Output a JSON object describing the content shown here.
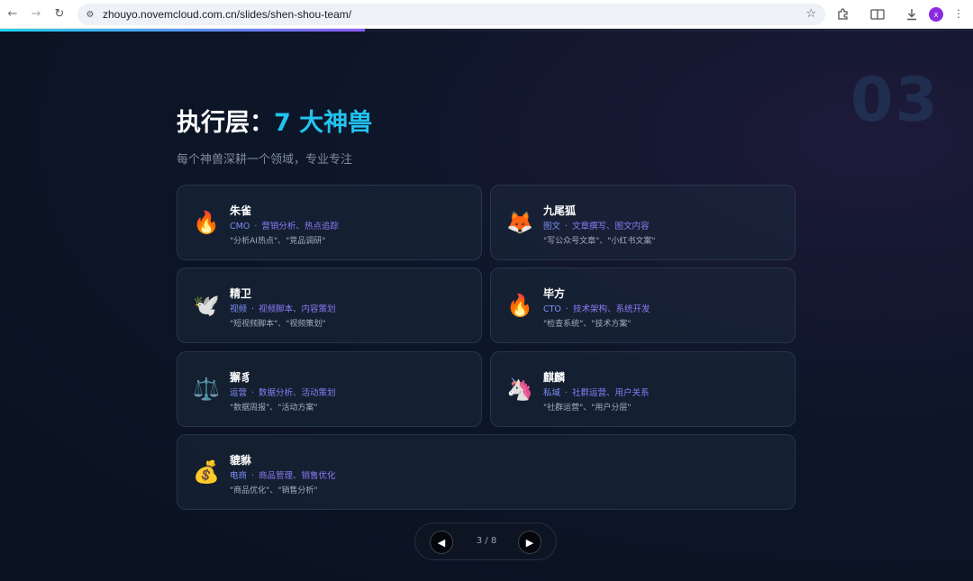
{
  "browser": {
    "url": "zhouyo.novemcloud.com.cn/slides/shen-shou-team/",
    "avatar_initial": "x",
    "icons": {
      "back": "arrow-left-icon",
      "forward": "arrow-right-icon",
      "reload": "reload-icon",
      "site": "tune-icon",
      "bookmark": "star-icon",
      "extensions": "puzzle-icon",
      "reader": "reading-mode-icon",
      "download": "download-icon",
      "menu": "more-vertical-icon"
    }
  },
  "slide": {
    "progress": 0.375,
    "progress_color_start": "#22d3ee",
    "progress_color_end": "#8b5cf6",
    "accent_color": "#22c3f0",
    "big_number": "03",
    "title_prefix": "执行层：",
    "title_accent": "7 大神兽",
    "subtitle": "每个神兽深耕一个领域，专业专注",
    "cards": [
      {
        "emoji": "🔥",
        "icon": "fire-icon",
        "name": "朱雀",
        "role": "CMO",
        "skills": "营销分析、热点追踪",
        "examples": "\"分析AI热点\"、\"竞品调研\""
      },
      {
        "emoji": "🦊",
        "icon": "fox-icon",
        "name": "九尾狐",
        "role": "图文",
        "skills": "文章撰写、图文内容",
        "examples": "\"写公众号文章\"、\"小红书文案\""
      },
      {
        "emoji": "🕊️",
        "icon": "dove-icon",
        "name": "精卫",
        "role": "视频",
        "skills": "视频脚本、内容策划",
        "examples": "\"短视频脚本\"、\"视频策划\""
      },
      {
        "emoji": "🔥",
        "icon": "fire-icon",
        "name": "毕方",
        "role": "CTO",
        "skills": "技术架构、系统开发",
        "examples": "\"检查系统\"、\"技术方案\""
      },
      {
        "emoji": "⚖️",
        "icon": "scales-icon",
        "name": "獬豸",
        "role": "运营",
        "skills": "数据分析、活动策划",
        "examples": "\"数据周报\"、\"活动方案\""
      },
      {
        "emoji": "🦄",
        "icon": "unicorn-icon",
        "name": "麒麟",
        "role": "私域",
        "skills": "社群运营、用户关系",
        "examples": "\"社群运营\"、\"用户分层\""
      },
      {
        "emoji": "💰",
        "icon": "money-bag-icon",
        "name": "貔貅",
        "role": "电商",
        "skills": "商品管理、销售优化",
        "examples": "\"商品优化\"、\"销售分析\""
      }
    ],
    "pager": {
      "prev_icon": "triangle-left-icon",
      "next_icon": "triangle-right-icon",
      "current": 3,
      "total": 8,
      "label": "3 / 8"
    }
  }
}
